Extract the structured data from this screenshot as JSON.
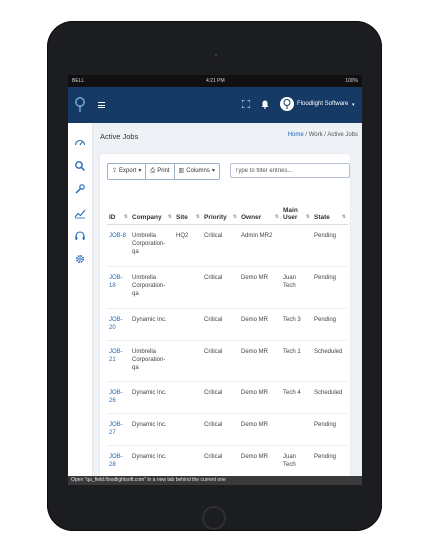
{
  "status_bar": {
    "carrier": "BELL",
    "time": "4:21 PM",
    "battery": "100%"
  },
  "navbar": {
    "user_name": "Floodlight Software"
  },
  "page": {
    "title": "Active Jobs",
    "breadcrumb": [
      "Home",
      "Work",
      "Active Jobs"
    ]
  },
  "toolbar": {
    "export_label": "Export",
    "print_label": "Print",
    "columns_label": "Columns",
    "filter_placeholder": "Type to filter entries..."
  },
  "table": {
    "headers": [
      "ID",
      "Company",
      "Site",
      "Priority",
      "Owner",
      "Main User",
      "State"
    ],
    "rows": [
      {
        "id": "JOB-8",
        "company": "Umbrella Corporation-qa",
        "site": "HQ2",
        "priority": "Critical",
        "owner": "Admin MR2",
        "main_user": "",
        "state": "Pending"
      },
      {
        "id": "JOB-18",
        "company": "Umbrella Corporation-qa",
        "site": "",
        "priority": "Critical",
        "owner": "Demo MR",
        "main_user": "Juan Tech",
        "state": "Pending"
      },
      {
        "id": "JOB-20",
        "company": "Dynamic Inc.",
        "site": "",
        "priority": "Critical",
        "owner": "Demo MR",
        "main_user": "Tech 3",
        "state": "Pending"
      },
      {
        "id": "JOB-21",
        "company": "Umbrella Corporation-qa",
        "site": "",
        "priority": "Critical",
        "owner": "Demo MR",
        "main_user": "Tech 1",
        "state": "Scheduled"
      },
      {
        "id": "JOB-26",
        "company": "Dynamic Inc.",
        "site": "",
        "priority": "Critical",
        "owner": "Demo MR",
        "main_user": "Tech 4",
        "state": "Scheduled"
      },
      {
        "id": "JOB-27",
        "company": "Dynamic Inc.",
        "site": "",
        "priority": "Critical",
        "owner": "Demo MR",
        "main_user": "",
        "state": "Pending"
      },
      {
        "id": "JOB-28",
        "company": "Dynamic Inc.",
        "site": "",
        "priority": "Critical",
        "owner": "Demo MR",
        "main_user": "Juan Tech",
        "state": "Pending"
      }
    ]
  },
  "toast": "Open \"qa_field.floodlightsoft.com\" in a new tab behind the current one",
  "colors": {
    "navbar": "#153a66",
    "link": "#1e6bb8",
    "sidebar_icon": "#1e6bb8"
  }
}
